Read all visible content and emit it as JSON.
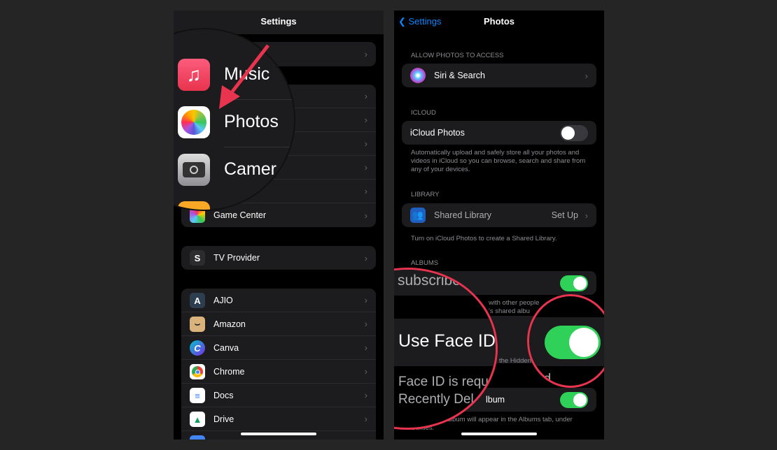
{
  "left": {
    "title": "Settings",
    "group2_last": "Game Center",
    "tv": "TV Provider",
    "apps": [
      "AJIO",
      "Amazon",
      "Canva",
      "Chrome",
      "Docs",
      "Drive"
    ],
    "magnified": [
      "Music",
      "Photos",
      "Camer"
    ]
  },
  "right": {
    "back": "Settings",
    "title": "Photos",
    "sec_access": "ALLOW PHOTOS TO ACCESS",
    "siri": "Siri & Search",
    "sec_icloud": "ICLOUD",
    "icloud_photos": "iCloud Photos",
    "icloud_photos_on": false,
    "icloud_note": "Automatically upload and safely store all your photos and videos in iCloud so you can browse, search and share from any of your devices.",
    "sec_library": "LIBRARY",
    "shared_library": "Shared Library",
    "shared_value": "Set Up",
    "library_note": "Turn on iCloud Photos to create a Shared Library.",
    "sec_albums": "ALBUMS",
    "shared_albums_note_frag1": "with other people",
    "shared_albums_note_frag2": "'s shared albu",
    "faceid_note_frag": "the Hidden",
    "hidden_album_frag": "lbum",
    "hidden_note": "The Hidden album will appear in the Albums tab, under Utilities.",
    "mag_subscribe": "subscribe t-",
    "mag_faceid": "Use Face ID",
    "mag_note1": "Face ID is requ",
    "mag_note1b": "nd",
    "mag_note2": "Recently Del",
    "shared_albums_on": true,
    "faceid_on": true,
    "hidden_on": true
  },
  "colors": {
    "accent": "#0a84ff",
    "toggle_on": "#30d158",
    "highlight": "#e8344e"
  }
}
